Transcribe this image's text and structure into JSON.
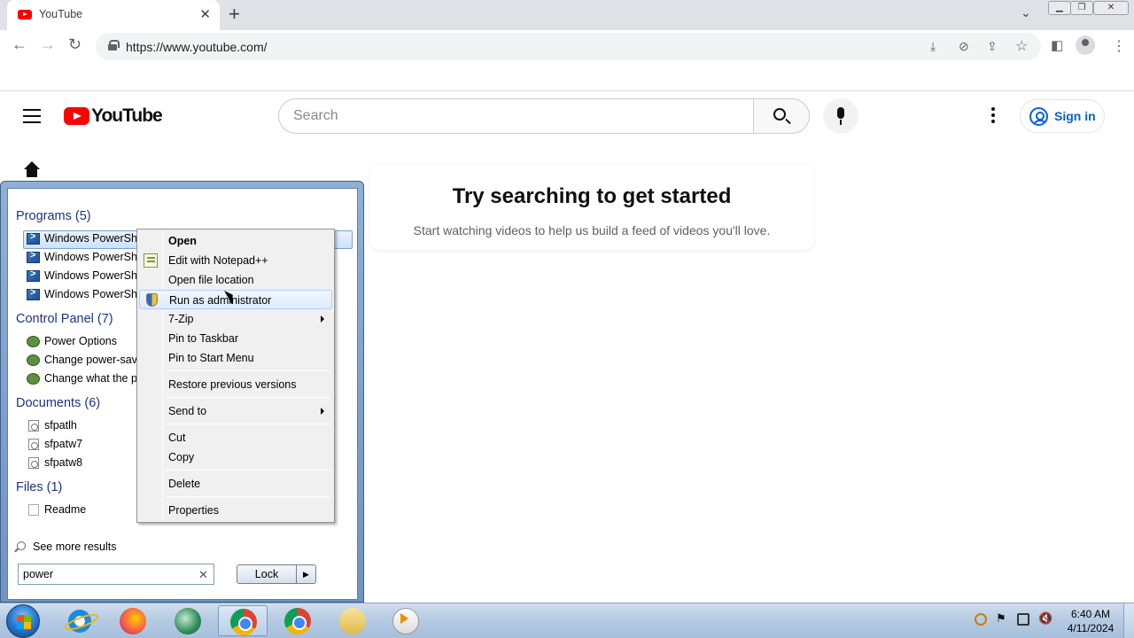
{
  "browser": {
    "tab_title": "YouTube",
    "tab_close": "✕",
    "new_tab": "+",
    "url": "https://www.youtube.com/"
  },
  "youtube": {
    "logo_text": "YouTube",
    "search_placeholder": "Search",
    "sign_in": "Sign in",
    "promo_title": "Try searching to get started",
    "promo_subtitle": "Start watching videos to help us build a feed of videos you'll love."
  },
  "start_menu": {
    "groups": {
      "programs": "Programs (5)",
      "control_panel": "Control Panel (7)",
      "documents": "Documents (6)",
      "files": "Files (1)"
    },
    "programs": [
      "Windows PowerShell",
      "Windows PowerShe",
      "Windows PowerShe",
      "Windows PowerShe"
    ],
    "control_panel": [
      "Power Options",
      "Change power-savin",
      "Change what the po"
    ],
    "documents": [
      "sfpatlh",
      "sfpatw7",
      "sfpatw8"
    ],
    "files": [
      "Readme"
    ],
    "see_more": "See more results",
    "search_value": "power",
    "search_clear": "✕",
    "lock_label": "Lock",
    "lock_arrow": "▶"
  },
  "context_menu": {
    "items": [
      "Open",
      "Edit with Notepad++",
      "Open file location",
      "Run as administrator",
      "7-Zip",
      "Pin to Taskbar",
      "Pin to Start Menu",
      "Restore previous versions",
      "Send to",
      "Cut",
      "Copy",
      "Delete",
      "Properties"
    ],
    "highlighted": "Run as administrator"
  },
  "taskbar": {
    "apps": [
      "internet-explorer",
      "firefox",
      "green-app",
      "chrome-active",
      "chrome",
      "file-explorer",
      "media-player"
    ],
    "clock_time": "6:40 AM",
    "clock_date": "4/11/2024"
  }
}
